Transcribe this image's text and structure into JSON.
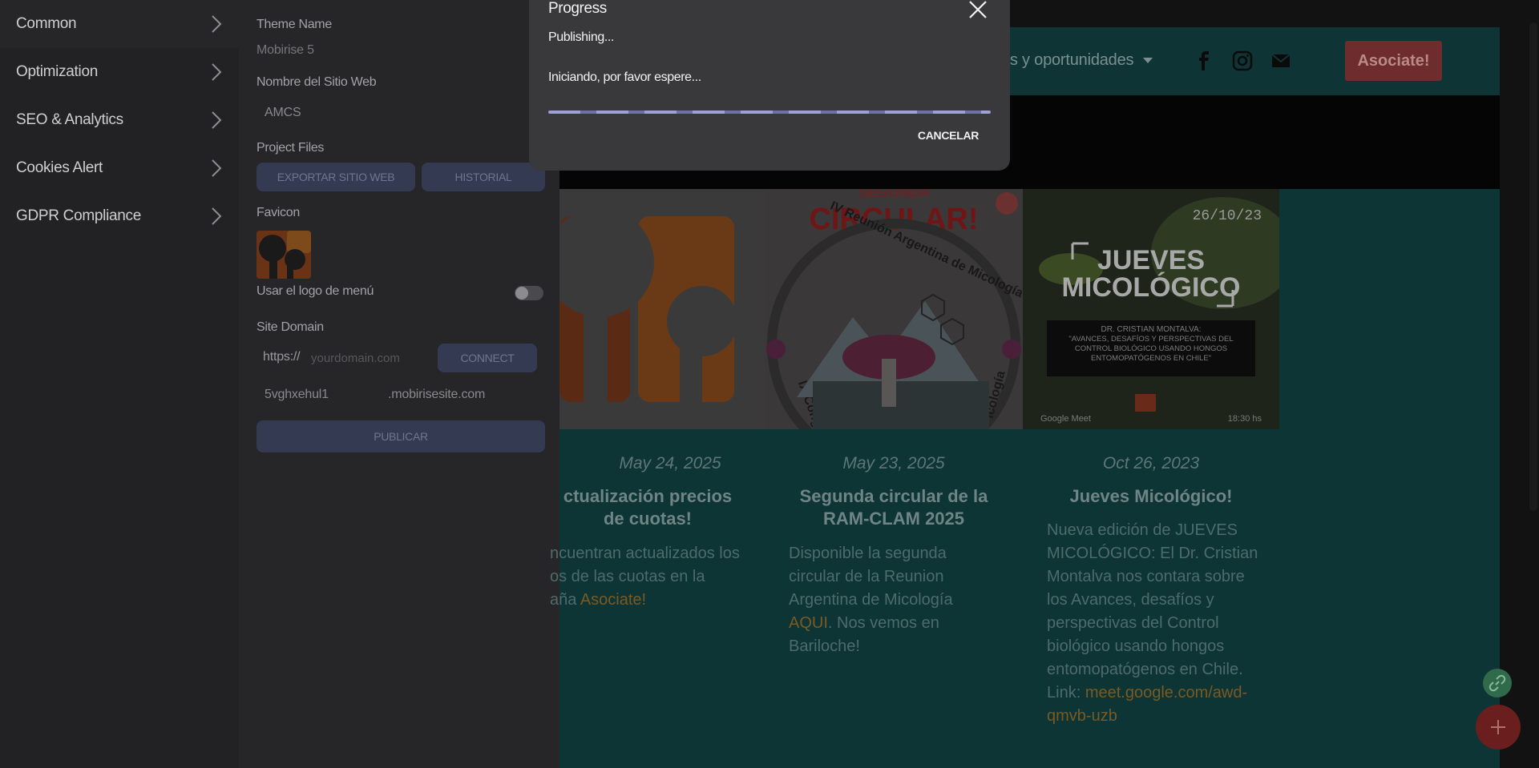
{
  "left_nav": {
    "items": [
      {
        "label": "Common"
      },
      {
        "label": "Optimization"
      },
      {
        "label": "SEO & Analytics"
      },
      {
        "label": "Cookies Alert"
      },
      {
        "label": "GDPR Compliance"
      }
    ]
  },
  "settings": {
    "theme_name_label": "Theme Name",
    "theme_name_value": "Mobirise 5",
    "site_name_label": "Nombre del Sitio Web",
    "site_name_value": "AMCS",
    "project_files_label": "Project Files",
    "export_button": "EXPORTAR SITIO WEB",
    "history_button": "HISTORIAL",
    "favicon_label": "Favicon",
    "menu_logo_label": "Usar el logo de menú",
    "menu_logo_enabled": false,
    "site_domain_label": "Site Domain",
    "protocol": "https://",
    "domain_placeholder": "yourdomain.com",
    "connect_button": "CONNECT",
    "subdomain": "5vghxehul1",
    "subdomain_suffix": ".mobirisesite.com",
    "publish_button": "PUBLICAR"
  },
  "site_preview": {
    "nav_link": "des y oportunidades",
    "social_icons": [
      "facebook-icon",
      "instagram-icon",
      "mail-icon"
    ],
    "cta_label": "Asociate!",
    "cards": [
      {
        "date": "May 24, 2025",
        "title": "ctualización precios de cuotas!",
        "text_lines": [
          "ncuentran actualizados los",
          "os de las cuotas en la"
        ],
        "text_tail": "aña ",
        "link": "Asociate!"
      },
      {
        "image_heading_top": "SEGUNDA",
        "image_heading": "CIRCULAR!",
        "image_ring_text": "IV Reunión Argentina de Micología",
        "image_ring_left": "IX Cong",
        "image_ring_right": "icología",
        "date": "May 23, 2025",
        "title": "Segunda circular de la RAM-CLAM 2025",
        "text_before": "Disponible la segunda circular de la Reunion Argentina de Micología ",
        "link": "AQUI",
        "text_after": ". Nos vemos en Bariloche!"
      },
      {
        "image_date": "26/10/23",
        "image_heading_1": "JUEVES",
        "image_heading_2": "MICOLÓGICO",
        "image_speaker": "DR. CRISTIAN MONTALVA:",
        "image_talk": "\"AVANCES, DESAFÍOS Y PERSPECTIVAS DEL CONTROL BIOLÓGICO USANDO HONGOS ENTOMOPATÓGENOS EN CHILE\"",
        "image_place": "Google Meet",
        "image_time": "18:30 hs",
        "date": "Oct 26, 2023",
        "title": "Jueves Micológico!",
        "text": "Nueva edición de JUEVES MICOLÓGICO: El Dr. Cristian Montalva nos contara sobre los Avances, desafíos y perspectivas del Control biológico usando hongos entomopatógenos en Chile.",
        "link_label": "Link: ",
        "link": "meet.google.com/awd-qmvb-uzb"
      }
    ]
  },
  "modal": {
    "title": "Progress",
    "status": "Publishing...",
    "message": "Iniciando, por favor espere...",
    "progress": 1.0,
    "cancel_label": "CANCELAR"
  },
  "colors": {
    "modal_bg": "#39393c",
    "accent": "#5a5e80",
    "site_teal": "#0d3536",
    "cta": "#6e2c2c"
  }
}
